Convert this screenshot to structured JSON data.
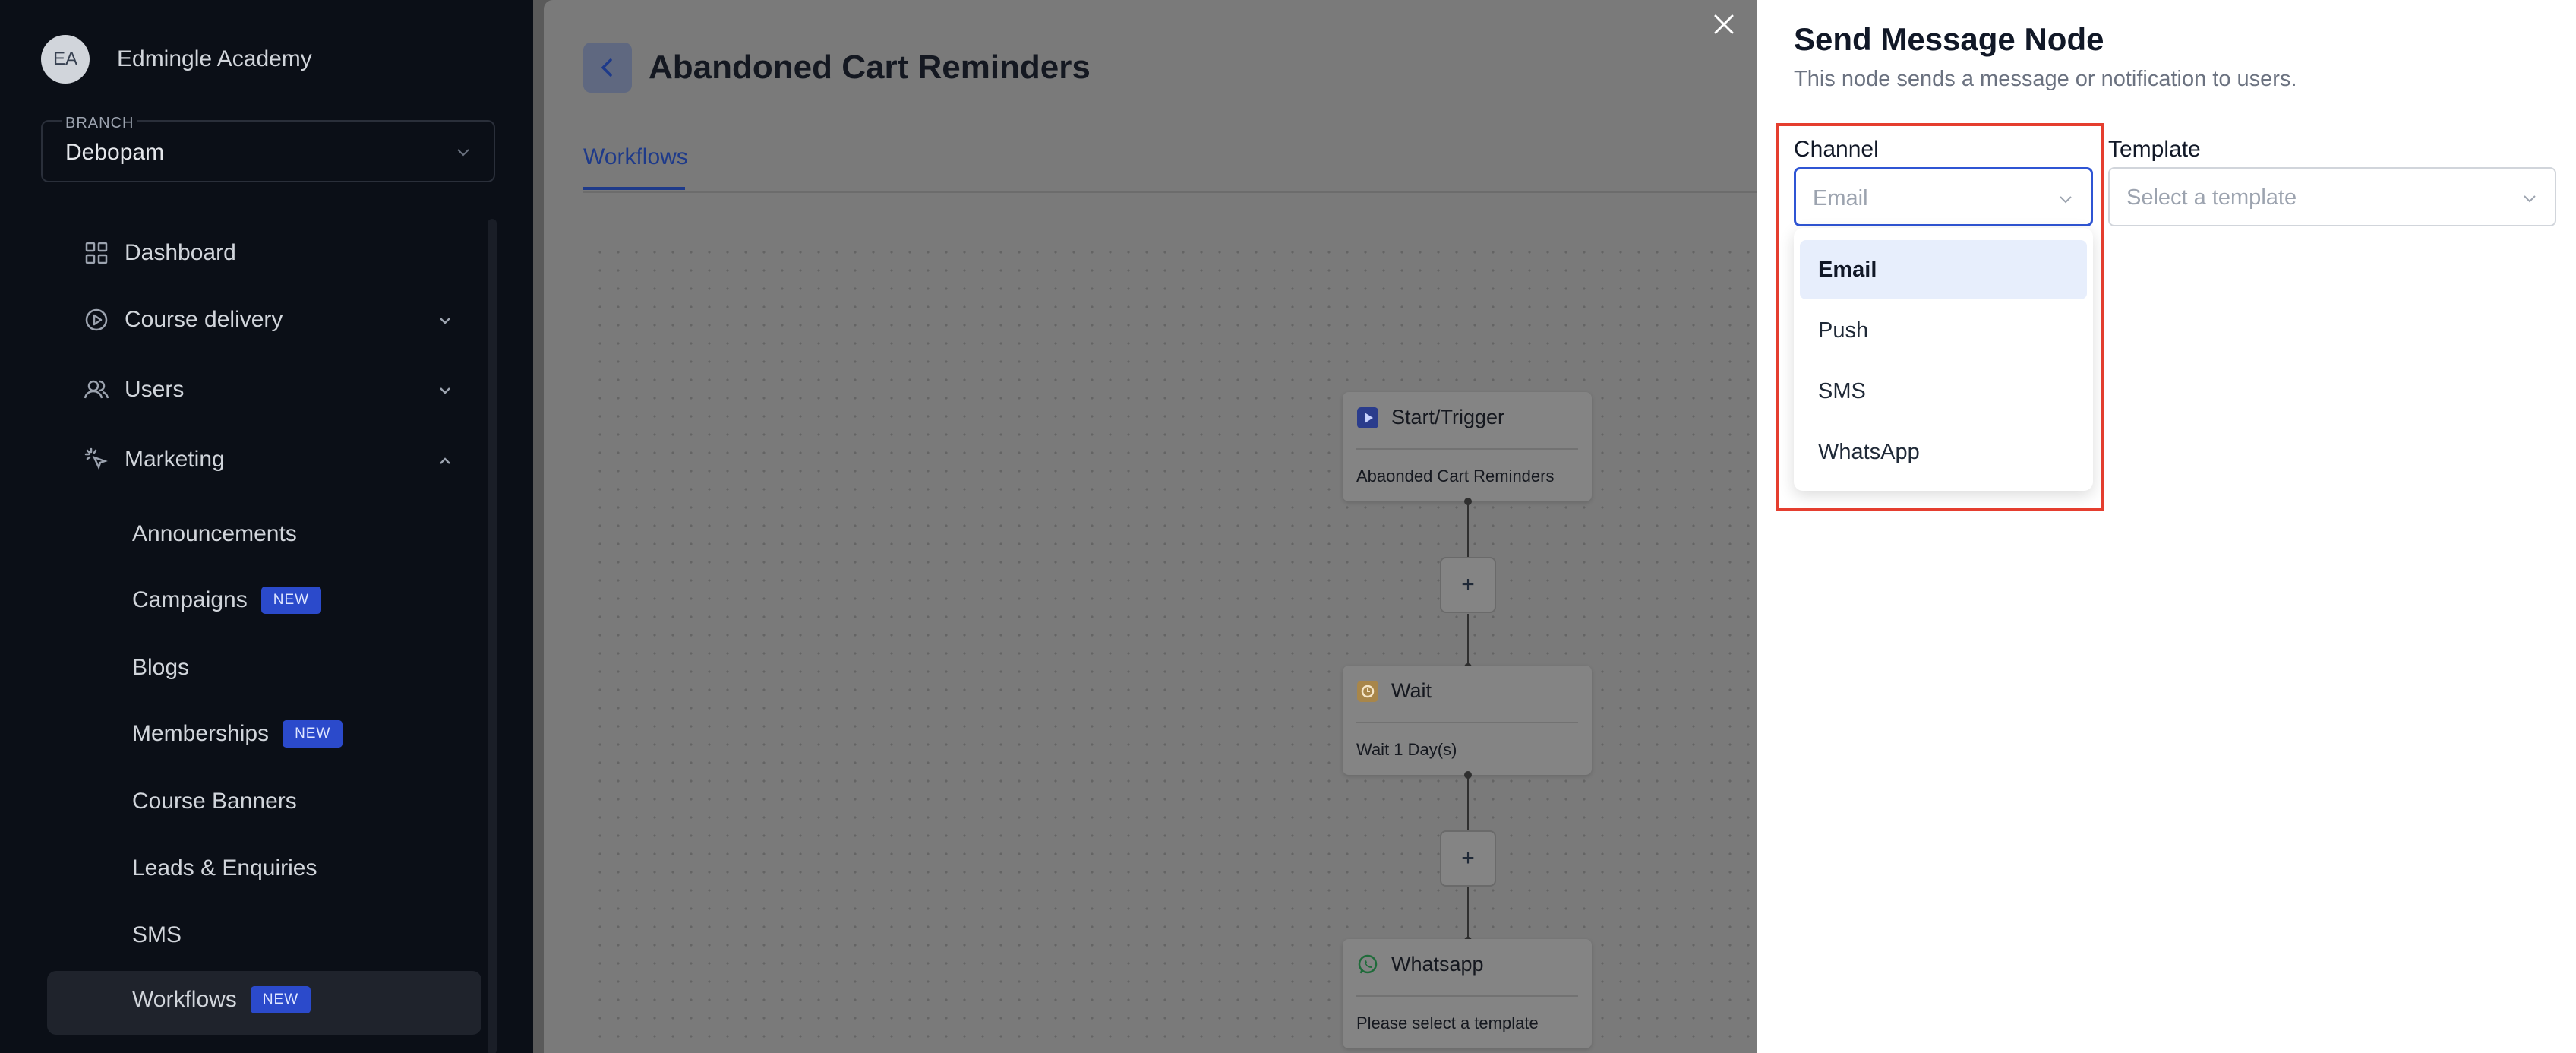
{
  "org": {
    "initials": "EA",
    "name": "Edmingle Academy"
  },
  "branch": {
    "label": "BRANCH",
    "value": "Debopam"
  },
  "sidebar": {
    "items": [
      {
        "label": "Dashboard"
      },
      {
        "label": "Course delivery"
      },
      {
        "label": "Users"
      },
      {
        "label": "Marketing"
      }
    ],
    "marketing_subitems": [
      {
        "label": "Announcements"
      },
      {
        "label": "Campaigns",
        "badge": "NEW"
      },
      {
        "label": "Blogs"
      },
      {
        "label": "Memberships",
        "badge": "NEW"
      },
      {
        "label": "Course Banners"
      },
      {
        "label": "Leads & Enquiries"
      },
      {
        "label": "SMS"
      },
      {
        "label": "Workflows",
        "badge": "NEW"
      }
    ]
  },
  "main": {
    "title": "Abandoned Cart Reminders",
    "tab": "Workflows",
    "nodes": [
      {
        "title": "Start/Trigger",
        "subtitle": "Abaonded Cart Reminders"
      },
      {
        "title": "Wait",
        "subtitle": "Wait 1 Day(s)"
      },
      {
        "title": "Whatsapp",
        "subtitle": "Please select a template"
      }
    ],
    "plus": "+"
  },
  "panel": {
    "title": "Send Message Node",
    "description": "This node sends a message or notification to users.",
    "channel_label": "Channel",
    "channel_value": "Email",
    "template_label": "Template",
    "template_placeholder": "Select a template",
    "channel_options": [
      "Email",
      "Push",
      "SMS",
      "WhatsApp"
    ],
    "selected_option": "Email"
  },
  "colors": {
    "sidebar_bg": "#0b0f17",
    "accent_blue": "#2f55d4",
    "badge_blue": "#2b4acb",
    "highlight_red": "#e53e2f",
    "option_selected_bg": "#e7eefc"
  }
}
